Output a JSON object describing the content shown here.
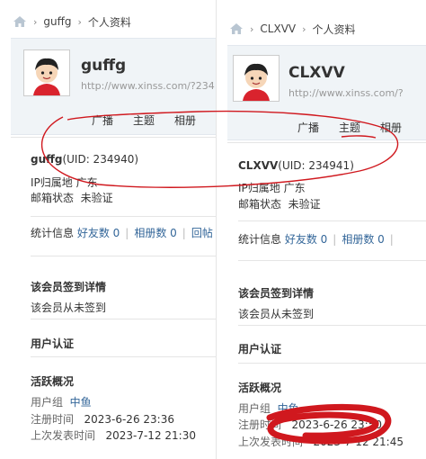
{
  "left": {
    "breadcrumb": {
      "user": "guffg",
      "page": "个人资料"
    },
    "profile": {
      "name": "guffg",
      "url": "http://www.xinss.com/?234"
    },
    "tabs": [
      "广播",
      "主题",
      "相册"
    ],
    "uid_line": {
      "name": "guffg",
      "uid": "(UID: 234940)"
    },
    "ip": {
      "label": "IP归属地",
      "value": "广东"
    },
    "email": {
      "label": "邮箱状态",
      "value": "未验证"
    },
    "stats": {
      "label": "统计信息",
      "friends": "好友数 0",
      "albums": "相册数 0",
      "more": "回帖"
    },
    "checkin": {
      "title": "该会员签到详情",
      "text": "该会员从未签到"
    },
    "verify": {
      "title": "用户认证"
    },
    "activity": {
      "title": "活跃概况",
      "group_label": "用户组",
      "group_value": "中鱼",
      "reg_label": "注册时间",
      "reg_value": "2023-6-26 23:36",
      "post_label": "上次发表时间",
      "post_value": "2023-7-12 21:30"
    }
  },
  "right": {
    "breadcrumb": {
      "user": "CLXVV",
      "page": "个人资料"
    },
    "profile": {
      "name": "CLXVV",
      "url": "http://www.xinss.com/?"
    },
    "tabs": [
      "广播",
      "主题",
      "相册"
    ],
    "uid_line": {
      "name": "CLXVV",
      "uid": "(UID: 234941)"
    },
    "ip": {
      "label": "IP归属地",
      "value": "广东"
    },
    "email": {
      "label": "邮箱状态",
      "value": "未验证"
    },
    "stats": {
      "label": "统计信息",
      "friends": "好友数 0",
      "albums": "相册数 0"
    },
    "checkin": {
      "title": "该会员签到详情",
      "text": "该会员从未签到"
    },
    "verify": {
      "title": "用户认证"
    },
    "activity": {
      "title": "活跃概况",
      "group_label": "用户组",
      "group_value": "中鱼",
      "reg_label": "注册时间",
      "reg_value": "2023-6-26 23:50",
      "post_label": "上次发表时间",
      "post_value": "2023-7-12 21:45"
    }
  },
  "colors": {
    "annotation": "#d0181e",
    "link": "#336699",
    "header_bg": "#f0f4f7"
  },
  "icons": [
    "home-icon",
    "avatar"
  ]
}
